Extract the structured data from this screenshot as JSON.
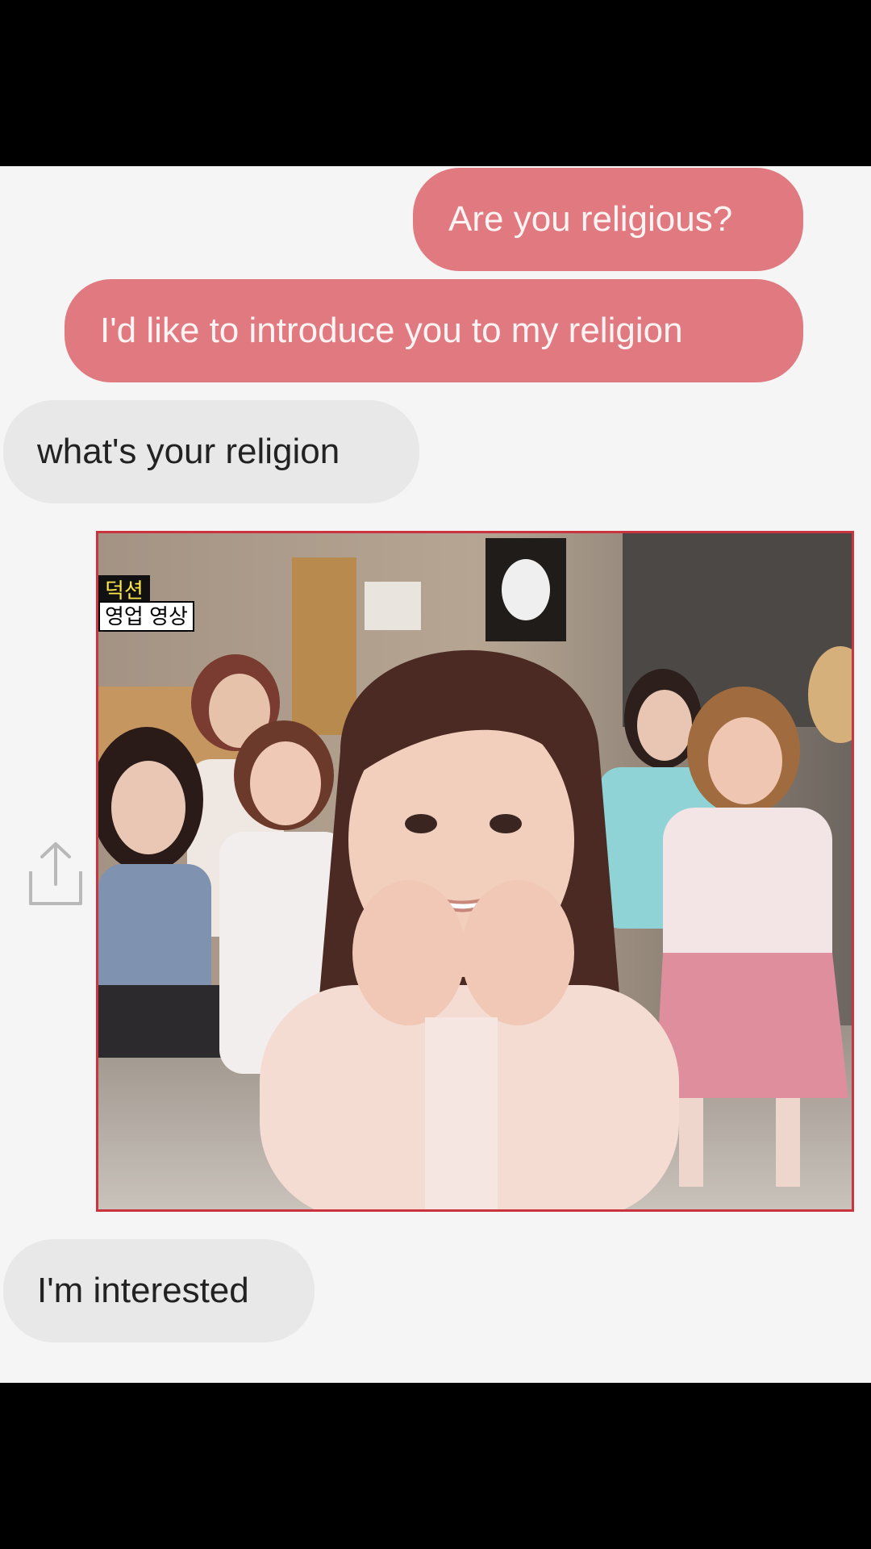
{
  "messages": [
    {
      "direction": "outgoing",
      "text": "Are you religious?"
    },
    {
      "direction": "outgoing",
      "text": "I'd like to introduce you to my religion"
    },
    {
      "direction": "incoming",
      "text": "what's your religion"
    },
    {
      "direction": "incoming",
      "text": "I'm interested"
    }
  ],
  "photo": {
    "caption_line1": "덕션",
    "caption_line2": "영업 영상"
  },
  "icons": {
    "share": "share-icon"
  },
  "colors": {
    "outgoing_bubble": "#e07a80",
    "incoming_bubble": "#e8e8e8",
    "chat_background": "#f5f5f5",
    "photo_border": "#c9343f"
  }
}
